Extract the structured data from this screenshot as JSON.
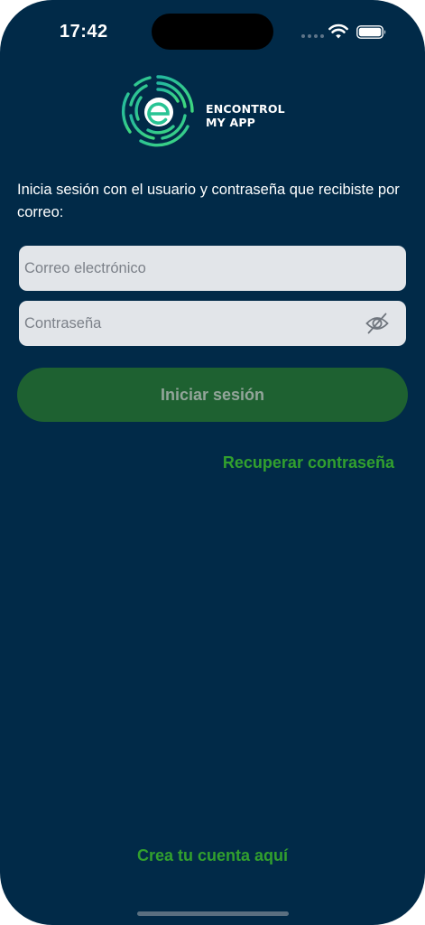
{
  "status_bar": {
    "time": "17:42",
    "icons": [
      "signal-dots-icon",
      "wifi-icon",
      "battery-icon"
    ]
  },
  "logo": {
    "line1": "ENCONTROL",
    "line2": "MY APP",
    "mark_icon": "encontrol-logo-icon"
  },
  "login": {
    "instructions": "Inicia sesión con el usuario y contraseña que recibiste por correo:",
    "email_placeholder": "Correo electrónico",
    "email_value": "",
    "password_placeholder": "Contraseña",
    "password_value": "",
    "password_toggle_icon": "eye-slash-icon",
    "submit_label": "Iniciar sesión",
    "forgot_password": "Recuperar contraseña",
    "create_account": "Crea tu cuenta aquí"
  },
  "colors": {
    "background": "#012a48",
    "input_background": "#e2e5e9",
    "button_background": "#1e6131",
    "button_text": "#93a59a",
    "link": "#32a02e",
    "text": "#ffffff"
  }
}
